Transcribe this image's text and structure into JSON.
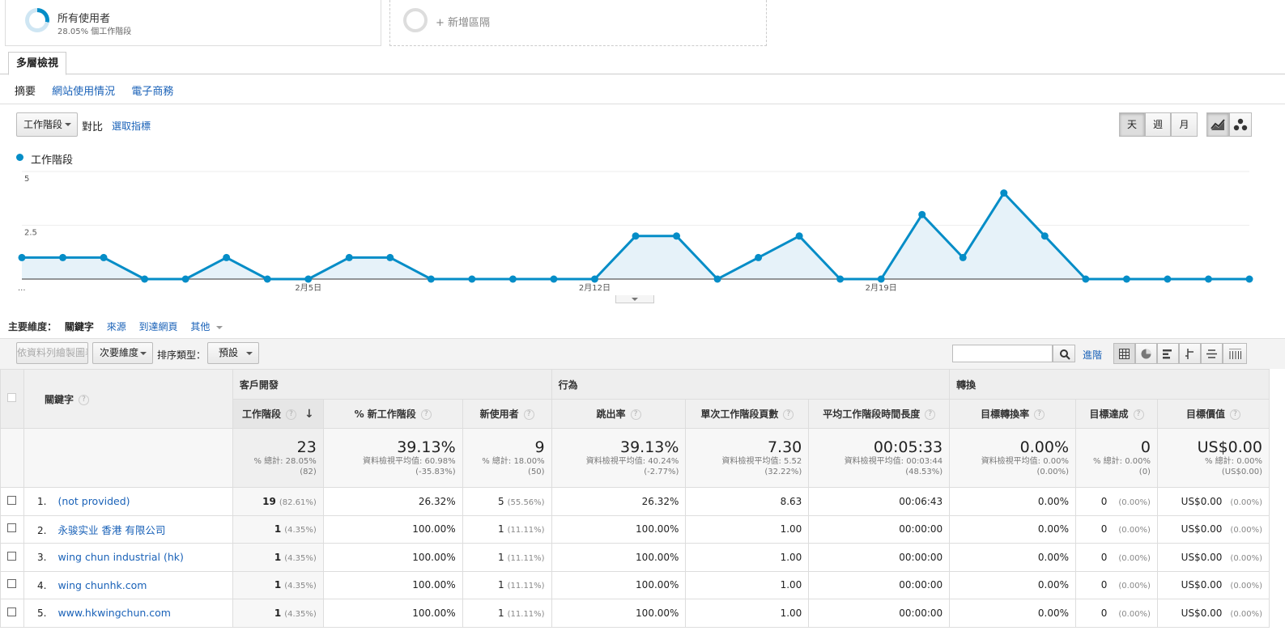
{
  "segments": {
    "active_name": "所有使用者",
    "active_sub": "28.05% 個工作階段",
    "add_label": "+ 新增區隔"
  },
  "tabs": {
    "drilldown": "多層檢視"
  },
  "subnav": {
    "items": [
      "摘要",
      "網站使用情況",
      "電子商務"
    ]
  },
  "chart_controls": {
    "metric_select": "工作階段",
    "versus": "對比",
    "select_metric": "選取指標",
    "periods": [
      "天",
      "週",
      "月"
    ]
  },
  "chart_data": {
    "type": "area",
    "series": [
      {
        "name": "工作階段",
        "values": [
          1,
          1,
          1,
          0,
          0,
          1,
          0,
          0,
          1,
          1,
          0,
          0,
          0,
          0,
          0,
          2,
          2,
          0,
          1,
          2,
          0,
          0,
          3,
          1,
          4,
          2,
          0,
          0,
          0,
          0,
          0
        ]
      }
    ],
    "x_ticks": [
      "...",
      "2月5日",
      "2月12日",
      "2月19日"
    ],
    "y_ticks": [
      "5",
      "2.5"
    ],
    "ylim": [
      0,
      5
    ],
    "color": "#058dc7",
    "fill": "#e6f2f9"
  },
  "dimension_bar": {
    "label": "主要維度：",
    "options": [
      "關鍵字",
      "來源",
      "到達網頁"
    ],
    "more": "其他"
  },
  "toolbar": {
    "plot_rows": "依資料列繪製圖表",
    "secondary": "次要維度",
    "sort_label": "排序類型：",
    "sort_value": "預設",
    "advanced": "進階"
  },
  "table": {
    "dim_header": "關鍵字",
    "groups": [
      "客戶開發",
      "行為",
      "轉換"
    ],
    "columns": [
      "工作階段",
      "% 新工作階段",
      "新使用者",
      "跳出率",
      "單次工作階段頁數",
      "平均工作階段時間長度",
      "目標轉換率",
      "目標達成",
      "目標價值"
    ],
    "totals": [
      {
        "v": "23",
        "l1": "% 總計: 28.05%",
        "l2": "(82)"
      },
      {
        "v": "39.13%",
        "l1": "資料檢視平均值: 60.98%",
        "l2": "(-35.83%)"
      },
      {
        "v": "9",
        "l1": "% 總計: 18.00%",
        "l2": "(50)"
      },
      {
        "v": "39.13%",
        "l1": "資料檢視平均值: 40.24%",
        "l2": "(-2.77%)"
      },
      {
        "v": "7.30",
        "l1": "資料檢視平均值: 5.52",
        "l2": "(32.22%)"
      },
      {
        "v": "00:05:33",
        "l1": "資料檢視平均值: 00:03:44",
        "l2": "(48.53%)"
      },
      {
        "v": "0.00%",
        "l1": "資料檢視平均值: 0.00%",
        "l2": "(0.00%)"
      },
      {
        "v": "0",
        "l1": "% 總計: 0.00%",
        "l2": "(0)"
      },
      {
        "v": "US$0.00",
        "l1": "% 總計: 0.00%",
        "l2": "(US$0.00)"
      }
    ],
    "rows": [
      {
        "n": "1.",
        "kw": "(not provided)",
        "s": "19",
        "sp": "(82.61%)",
        "pn": "26.32%",
        "nu": "5",
        "nup": "(55.56%)",
        "br": "26.32%",
        "pps": "8.63",
        "dur": "00:06:43",
        "cr": "0.00%",
        "gc": "0",
        "gcp": "(0.00%)",
        "gv": "US$0.00",
        "gvp": "(0.00%)"
      },
      {
        "n": "2.",
        "kw": "永骏实业 香港 有限公司",
        "s": "1",
        "sp": "(4.35%)",
        "pn": "100.00%",
        "nu": "1",
        "nup": "(11.11%)",
        "br": "100.00%",
        "pps": "1.00",
        "dur": "00:00:00",
        "cr": "0.00%",
        "gc": "0",
        "gcp": "(0.00%)",
        "gv": "US$0.00",
        "gvp": "(0.00%)"
      },
      {
        "n": "3.",
        "kw": "wing chun industrial (hk)",
        "s": "1",
        "sp": "(4.35%)",
        "pn": "100.00%",
        "nu": "1",
        "nup": "(11.11%)",
        "br": "100.00%",
        "pps": "1.00",
        "dur": "00:00:00",
        "cr": "0.00%",
        "gc": "0",
        "gcp": "(0.00%)",
        "gv": "US$0.00",
        "gvp": "(0.00%)"
      },
      {
        "n": "4.",
        "kw": "wing chunhk.com",
        "s": "1",
        "sp": "(4.35%)",
        "pn": "100.00%",
        "nu": "1",
        "nup": "(11.11%)",
        "br": "100.00%",
        "pps": "1.00",
        "dur": "00:00:00",
        "cr": "0.00%",
        "gc": "0",
        "gcp": "(0.00%)",
        "gv": "US$0.00",
        "gvp": "(0.00%)"
      },
      {
        "n": "5.",
        "kw": "www.hkwingchun.com",
        "s": "1",
        "sp": "(4.35%)",
        "pn": "100.00%",
        "nu": "1",
        "nup": "(11.11%)",
        "br": "100.00%",
        "pps": "1.00",
        "dur": "00:00:00",
        "cr": "0.00%",
        "gc": "0",
        "gcp": "(0.00%)",
        "gv": "US$0.00",
        "gvp": "(0.00%)"
      }
    ]
  }
}
